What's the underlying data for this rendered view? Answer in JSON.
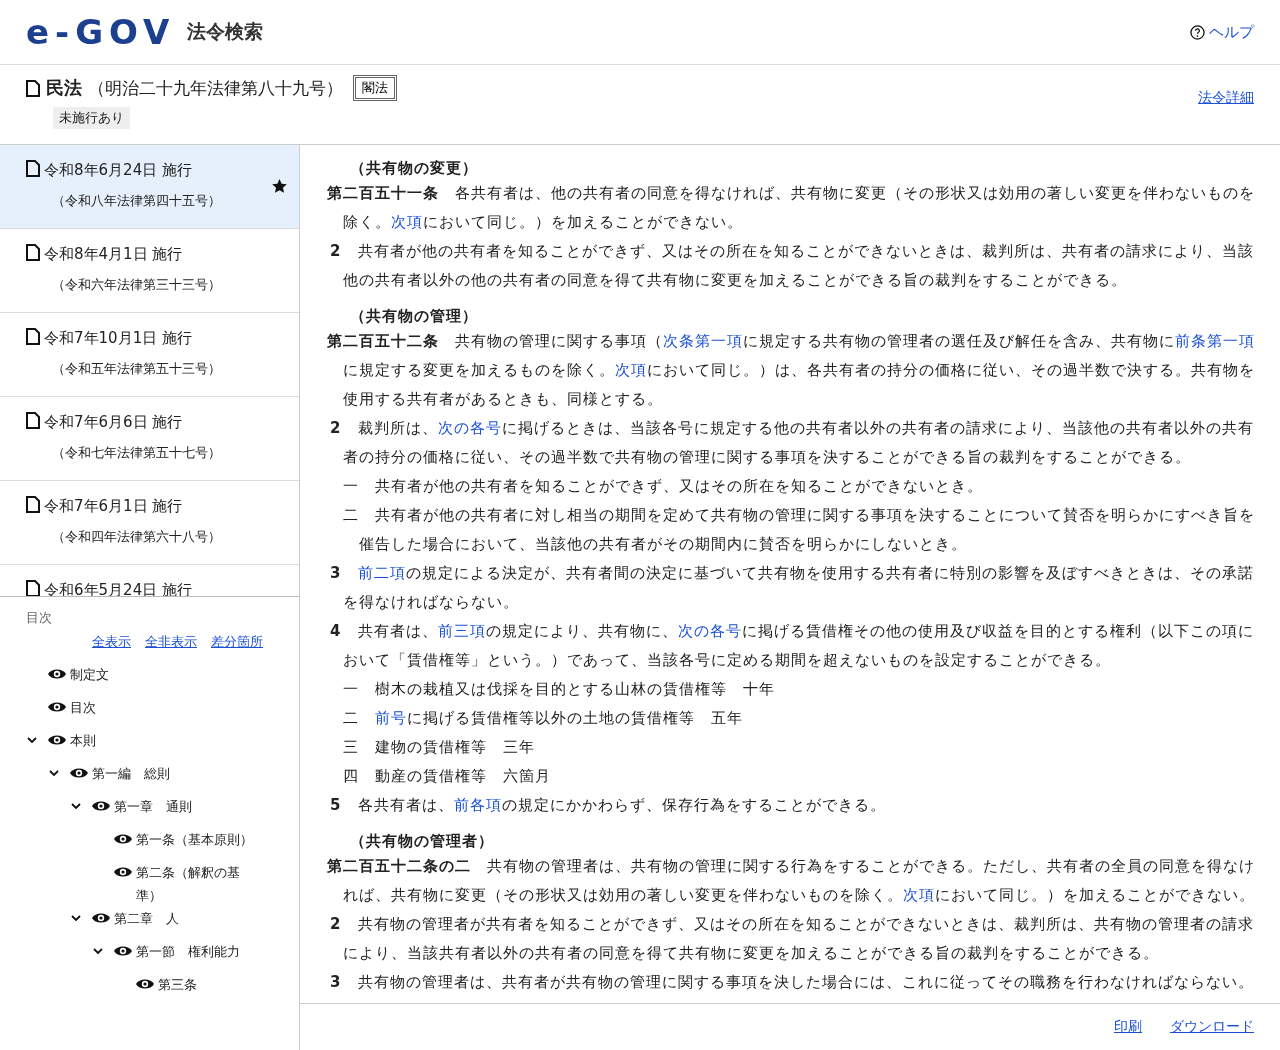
{
  "header": {
    "logo": "e-GOV",
    "site_title": "法令検索",
    "help": "ヘルプ"
  },
  "law": {
    "name": "民法",
    "number": "（明治二十九年法律第八十九号）",
    "type_button": "閣法",
    "tag": "未施行あり",
    "detail_link": "法令詳細"
  },
  "versions": [
    {
      "date": "令和8年6月24日 施行",
      "law": "（令和八年法律第四十五号）",
      "selected": true,
      "starred": true
    },
    {
      "date": "令和8年4月1日 施行",
      "law": "（令和六年法律第三十三号）",
      "selected": false,
      "starred": false
    },
    {
      "date": "令和7年10月1日 施行",
      "law": "（令和五年法律第五十三号）",
      "selected": false,
      "starred": false
    },
    {
      "date": "令和7年6月6日 施行",
      "law": "（令和七年法律第五十七号）",
      "selected": false,
      "starred": false
    },
    {
      "date": "令和7年6月1日 施行",
      "law": "（令和四年法律第六十八号）",
      "selected": false,
      "starred": false
    },
    {
      "date": "令和6年5月24日 施行",
      "selected": false,
      "starred": false
    }
  ],
  "toc": {
    "title": "目次",
    "links": [
      "全表示",
      "全非表示",
      "差分箇所"
    ],
    "items": [
      {
        "label": "制定文"
      },
      {
        "label": "目次"
      },
      {
        "label": "本則",
        "expanded": true,
        "children": [
          {
            "label": "第一編　総則",
            "expanded": true,
            "children": [
              {
                "label": "第一章　通則",
                "expanded": true,
                "children": [
                  {
                    "label": "第一条（基本原則）"
                  },
                  {
                    "label": "第二条（解釈の基準）"
                  }
                ]
              },
              {
                "label": "第二章　人",
                "expanded": true,
                "children": [
                  {
                    "label": "第一節　権利能力",
                    "expanded": true,
                    "children": [
                      {
                        "label": "第三条"
                      }
                    ]
                  }
                ]
              }
            ]
          }
        ]
      }
    ]
  },
  "articles": [
    {
      "caption": "（共有物の変更）",
      "number": "第二百五十一条",
      "paragraphs": [
        {
          "segments": [
            {
              "text": "各共有者は、他の共有者の同意を得なければ、共有物に変更（その形状又は効用の著しい変更を伴わないものを除く。"
            },
            {
              "text": "次項",
              "link": true
            },
            {
              "text": "において同じ。）を加えることができない。"
            }
          ]
        },
        {
          "num": "2",
          "segments": [
            {
              "text": "共有者が他の共有者を知ることができず、又はその所在を知ることができないときは、裁判所は、共有者の請求により、当該他の共有者以外の他の共有者の同意を得て共有物に変更を加えることができる旨の裁判をすることができる。"
            }
          ]
        }
      ]
    },
    {
      "caption": "（共有物の管理）",
      "number": "第二百五十二条",
      "paragraphs": [
        {
          "segments": [
            {
              "text": "共有物の管理に関する事項（"
            },
            {
              "text": "次条第一項",
              "link": true
            },
            {
              "text": "に規定する共有物の管理者の選任及び解任を含み、共有物に"
            },
            {
              "text": "前条第一項",
              "link": true
            },
            {
              "text": "に規定する変更を加えるものを除く。"
            },
            {
              "text": "次項",
              "link": true
            },
            {
              "text": "において同じ。）は、各共有者の持分の価格に従い、その過半数で決する。共有物を使用する共有者があるときも、同様とする。"
            }
          ]
        },
        {
          "num": "2",
          "segments": [
            {
              "text": "裁判所は、"
            },
            {
              "text": "次の各号",
              "link": true
            },
            {
              "text": "に掲げるときは、当該各号に規定する他の共有者以外の共有者の請求により、当該他の共有者以外の共有者の持分の価格に従い、その過半数で共有物の管理に関する事項を決することができる旨の裁判をすることができる。"
            }
          ],
          "items": [
            {
              "num": "一",
              "segments": [
                {
                  "text": "共有者が他の共有者を知ることができず、又はその所在を知ることができないとき。"
                }
              ]
            },
            {
              "num": "二",
              "segments": [
                {
                  "text": "共有者が他の共有者に対し相当の期間を定めて共有物の管理に関する事項を決することについて賛否を明らかにすべき旨を催告した場合において、当該他の共有者がその期間内に賛否を明らかにしないとき。"
                }
              ]
            }
          ]
        },
        {
          "num": "3",
          "segments": [
            {
              "text": "前二項",
              "link": true
            },
            {
              "text": "の規定による決定が、共有者間の決定に基づいて共有物を使用する共有者に特別の影響を及ぼすべきときは、その承諾を得なければならない。"
            }
          ]
        },
        {
          "num": "4",
          "segments": [
            {
              "text": "共有者は、"
            },
            {
              "text": "前三項",
              "link": true
            },
            {
              "text": "の規定により、共有物に、"
            },
            {
              "text": "次の各号",
              "link": true
            },
            {
              "text": "に掲げる賃借権その他の使用及び収益を目的とする権利（以下この項において「賃借権等」という。）であって、当該各号に定める期間を超えないものを設定することができる。"
            }
          ],
          "items": [
            {
              "num": "一",
              "segments": [
                {
                  "text": "樹木の栽植又は伐採を目的とする山林の賃借権等　十年"
                }
              ]
            },
            {
              "num": "二",
              "segments": [
                {
                  "text": "前号",
                  "link": true
                },
                {
                  "text": "に掲げる賃借権等以外の土地の賃借権等　五年"
                }
              ]
            },
            {
              "num": "三",
              "segments": [
                {
                  "text": "建物の賃借権等　三年"
                }
              ]
            },
            {
              "num": "四",
              "segments": [
                {
                  "text": "動産の賃借権等　六箇月"
                }
              ]
            }
          ]
        },
        {
          "num": "5",
          "segments": [
            {
              "text": "各共有者は、"
            },
            {
              "text": "前各項",
              "link": true
            },
            {
              "text": "の規定にかかわらず、保存行為をすることができる。"
            }
          ]
        }
      ]
    },
    {
      "caption": "（共有物の管理者）",
      "number": "第二百五十二条の二",
      "paragraphs": [
        {
          "segments": [
            {
              "text": "共有物の管理者は、共有物の管理に関する行為をすることができる。ただし、共有者の全員の同意を得なければ、共有物に変更（その形状又は効用の著しい変更を伴わないものを除く。"
            },
            {
              "text": "次項",
              "link": true
            },
            {
              "text": "において同じ。）を加えることができない。"
            }
          ]
        },
        {
          "num": "2",
          "segments": [
            {
              "text": "共有物の管理者が共有者を知ることができず、又はその所在を知ることができないときは、裁判所は、共有物の管理者の請求により、当該共有者以外の共有者の同意を得て共有物に変更を加えることができる旨の裁判をすることができる。"
            }
          ]
        },
        {
          "num": "3",
          "segments": [
            {
              "text": "共有物の管理者は、共有者が共有物の管理に関する事項を決した場合には、これに従ってその職務を行わなければならない。"
            }
          ]
        }
      ]
    }
  ],
  "footer": {
    "links": [
      "印刷",
      "ダウンロード"
    ]
  }
}
